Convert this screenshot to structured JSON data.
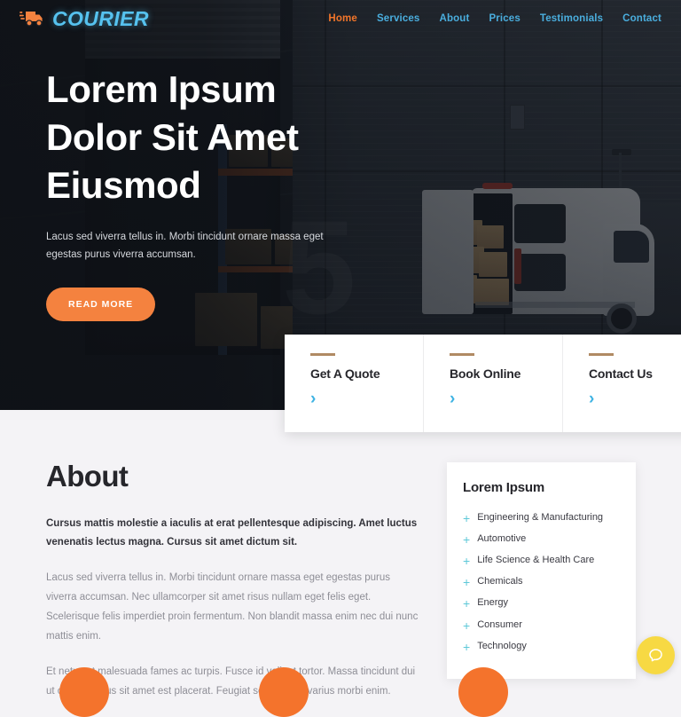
{
  "header": {
    "logo": {
      "icon": "delivery-truck-icon",
      "text": "COURIER",
      "color": "#56c2ef"
    },
    "nav": [
      {
        "label": "Home",
        "active": true
      },
      {
        "label": "Services",
        "active": false
      },
      {
        "label": "About",
        "active": false
      },
      {
        "label": "Prices",
        "active": false
      },
      {
        "label": "Testimonials",
        "active": false
      },
      {
        "label": "Contact",
        "active": false
      }
    ],
    "active_color": "#f2752a",
    "link_color": "#4aaede"
  },
  "hero": {
    "title": "Lorem Ipsum Dolor Sit Amet Eiusmod",
    "subtitle": "Lacus sed viverra tellus in. Morbi tincidunt ornare massa eget egestas purus viverra accumsan.",
    "button_label": "READ MORE",
    "button_color": "#f4823f"
  },
  "quick_cards": [
    {
      "title": "Get A Quote",
      "arrow": "›"
    },
    {
      "title": "Book Online",
      "arrow": "›"
    },
    {
      "title": "Contact Us",
      "arrow": "›"
    }
  ],
  "quick_card_bar_color": "#b08a63",
  "quick_card_arrow_color": "#3fb3e3",
  "about": {
    "heading": "About",
    "lead": "Cursus mattis molestie a iaculis at erat pellentesque adipiscing. Amet luctus venenatis lectus magna. Cursus sit amet dictum sit.",
    "paragraph_1": "Lacus sed viverra tellus in. Morbi tincidunt ornare massa eget egestas purus viverra accumsan. Nec ullamcorper sit amet risus nullam eget felis eget. Scelerisque felis imperdiet proin fermentum. Non blandit massa enim nec dui nunc mattis enim.",
    "paragraph_2": "Et netus et malesuada fames ac turpis. Fusce id velit ut tortor. Massa tincidunt dui ut ornare lectus sit amet est placerat. Feugiat scelerisque varius morbi enim."
  },
  "sidecard": {
    "heading": "Lorem Ipsum",
    "bullet_icon": "plus-icon",
    "bullet_color": "#5ec8d8",
    "items": [
      "Engineering & Manufacturing",
      "Automotive",
      "Life Science & Health Care",
      "Chemicals",
      "Energy",
      "Consumer",
      "Technology"
    ]
  },
  "bottom_circles": {
    "count": 3,
    "color": "#f4732c"
  },
  "chat_widget": {
    "icon": "chat-bubble-icon",
    "color": "#f7d943"
  }
}
